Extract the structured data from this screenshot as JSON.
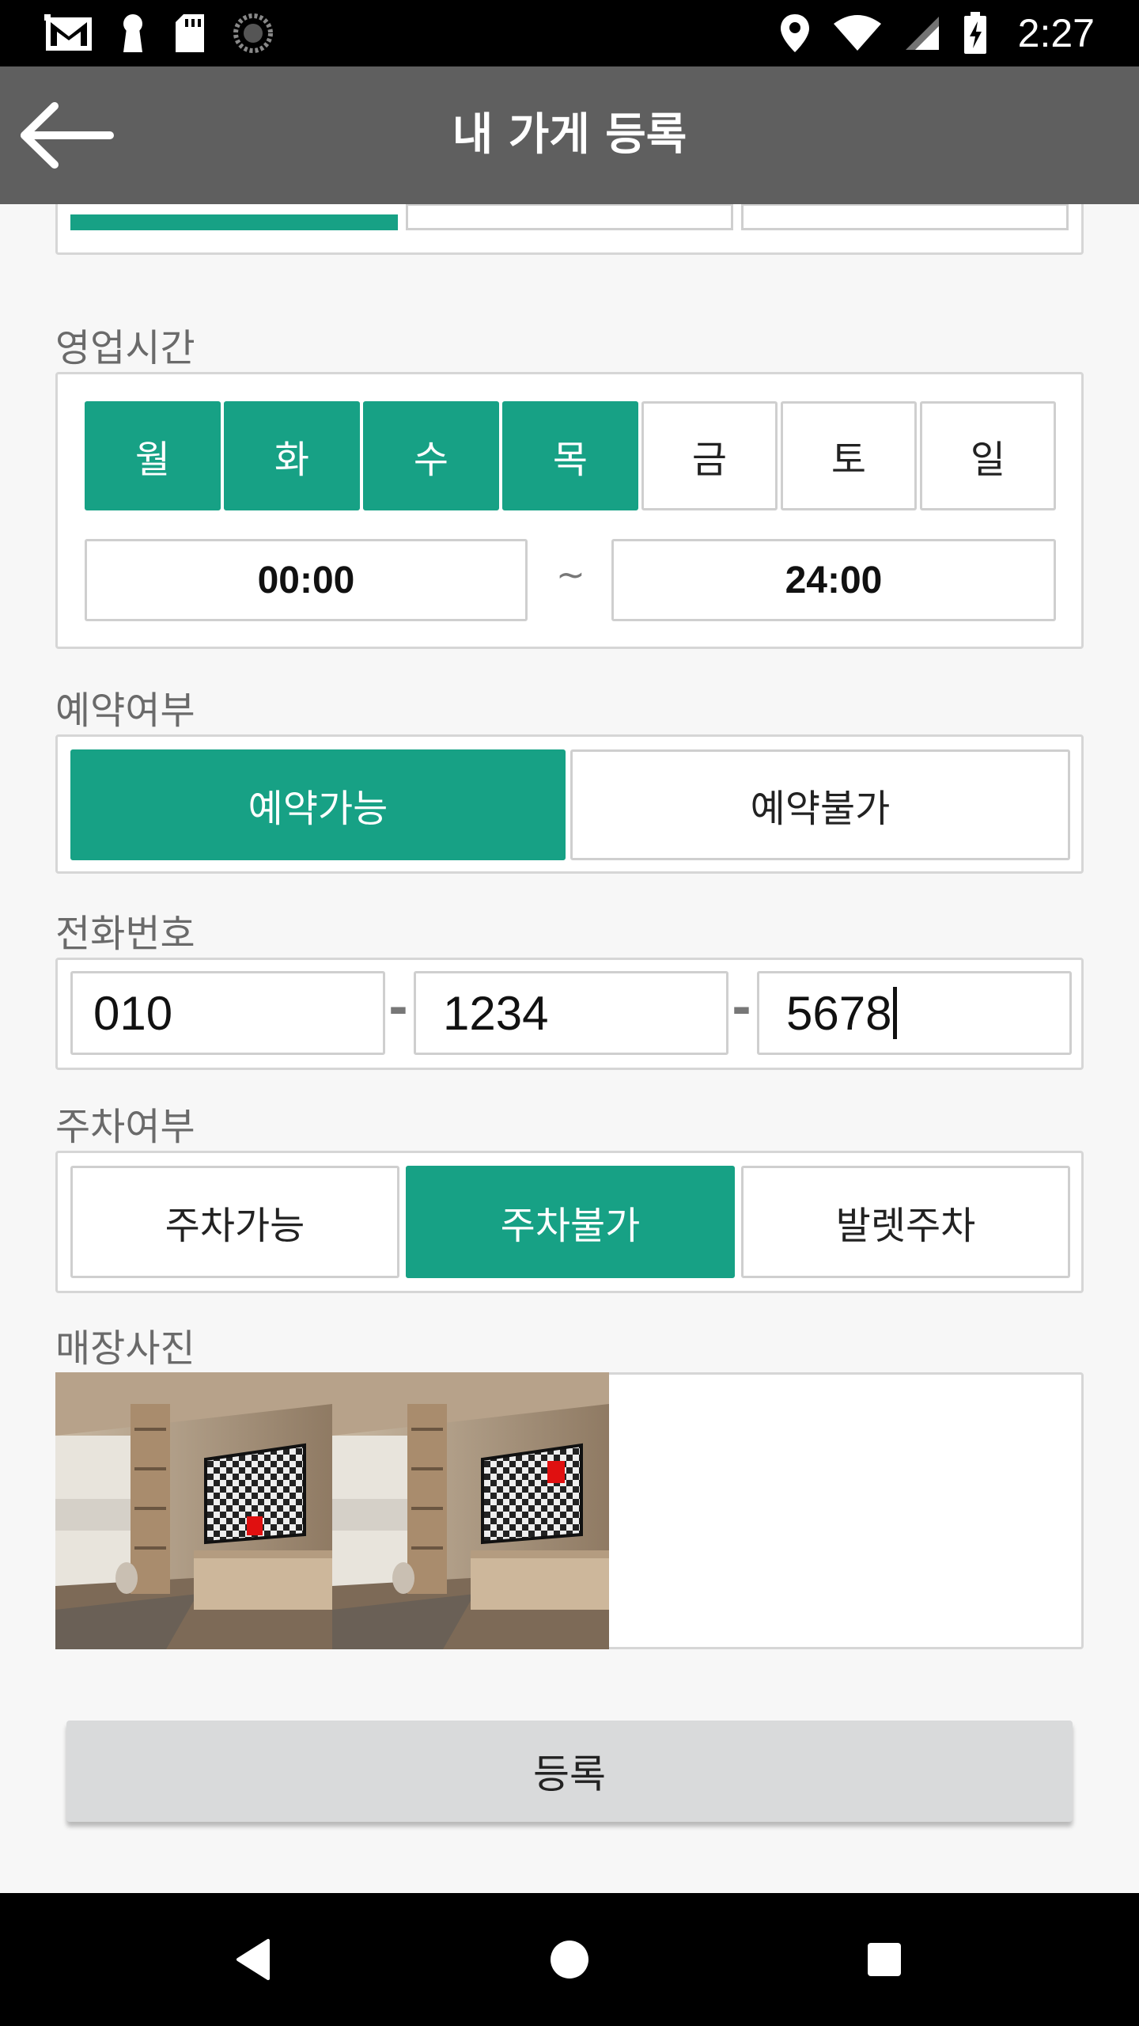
{
  "status_bar": {
    "time": "2:27",
    "left_icons": [
      "gmail-icon",
      "keyhole-icon",
      "sd-card-icon",
      "sync-icon"
    ],
    "right_icons": [
      "location-icon",
      "wifi-icon",
      "signal-icon",
      "battery-charging-icon"
    ]
  },
  "app_bar": {
    "title": "내 가게 등록",
    "back_icon": "arrow-left-icon"
  },
  "business_hours": {
    "label": "영업시간",
    "days": [
      {
        "label": "월",
        "selected": true
      },
      {
        "label": "화",
        "selected": true
      },
      {
        "label": "수",
        "selected": true
      },
      {
        "label": "목",
        "selected": true
      },
      {
        "label": "금",
        "selected": false
      },
      {
        "label": "토",
        "selected": false
      },
      {
        "label": "일",
        "selected": false
      }
    ],
    "open_time": "00:00",
    "separator": "~",
    "close_time": "24:00"
  },
  "reservation": {
    "label": "예약여부",
    "options": [
      {
        "label": "예약가능",
        "selected": true
      },
      {
        "label": "예약불가",
        "selected": false
      }
    ]
  },
  "phone": {
    "label": "전화번호",
    "part1": "010",
    "part2": "1234",
    "part3": "5678",
    "dash": "-"
  },
  "parking": {
    "label": "주차여부",
    "options": [
      {
        "label": "주차가능",
        "selected": false
      },
      {
        "label": "주차불가",
        "selected": true
      },
      {
        "label": "발렛주차",
        "selected": false
      }
    ]
  },
  "photos": {
    "label": "매장사진",
    "count": 2
  },
  "submit": {
    "label": "등록"
  },
  "nav_bar": {
    "icons": [
      "back-triangle-icon",
      "home-circle-icon",
      "recents-square-icon"
    ]
  },
  "colors": {
    "accent": "#17a185",
    "appbar": "#5f5f5f",
    "button": "#d9dadb"
  }
}
